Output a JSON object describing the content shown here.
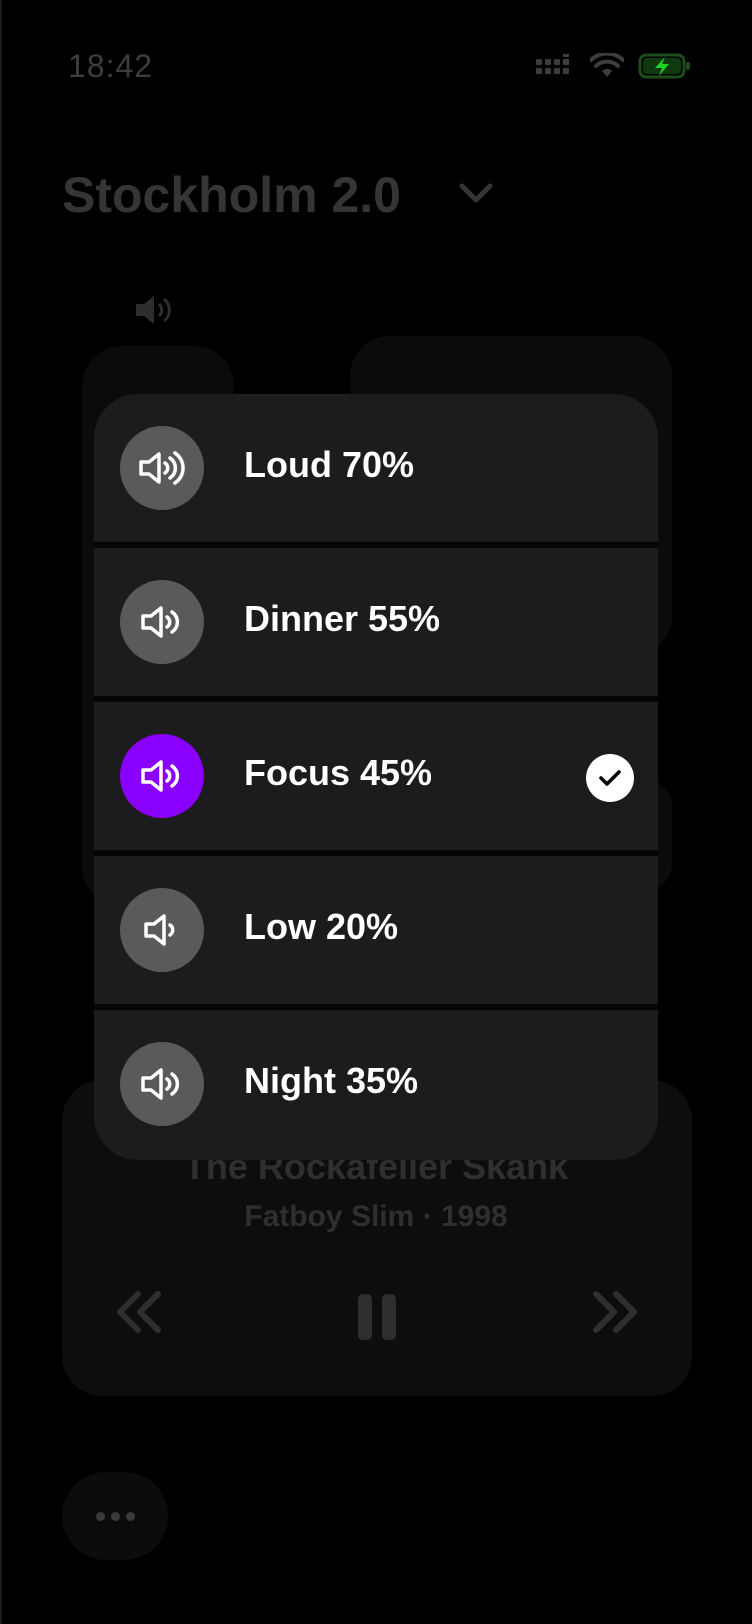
{
  "status": {
    "time": "18:42",
    "battery_color": "#1fd21f"
  },
  "header": {
    "room_name": "Stockholm 2.0"
  },
  "player": {
    "track_title": "The Rockafeller Skank",
    "track_subtitle": "Fatboy Slim · 1998"
  },
  "volume_presets": [
    {
      "label": "Loud 70%",
      "icon": "speaker-loud-icon",
      "selected": false
    },
    {
      "label": "Dinner 55%",
      "icon": "speaker-medium-icon",
      "selected": false
    },
    {
      "label": "Focus 45%",
      "icon": "speaker-medium-icon",
      "selected": true
    },
    {
      "label": "Low 20%",
      "icon": "speaker-low-icon",
      "selected": false
    },
    {
      "label": "Night 35%",
      "icon": "speaker-medium-icon",
      "selected": false
    }
  ],
  "colors": {
    "accent": "#8a00ff",
    "row_bg": "#1c1c1e",
    "icon_circle": "#5a5a5a"
  }
}
